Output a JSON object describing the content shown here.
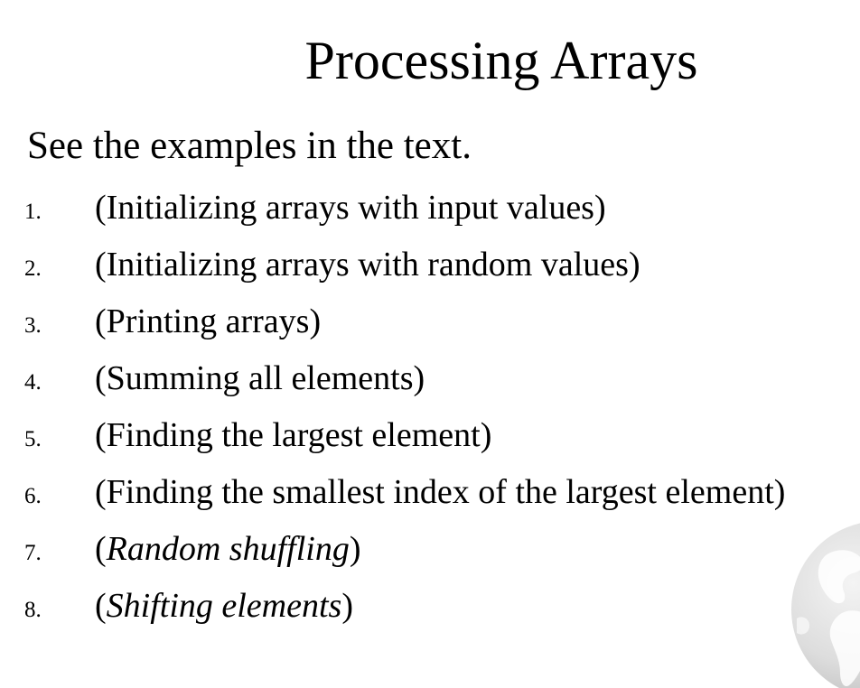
{
  "slide": {
    "title": "Processing Arrays",
    "intro": "See the examples in the text.",
    "items": [
      {
        "number": "1.",
        "before": "(",
        "text": "Initializing arrays with input values",
        "after": ")",
        "italic": false
      },
      {
        "number": "2.",
        "before": "(",
        "text": "Initializing arrays with random values",
        "after": ")",
        "italic": false
      },
      {
        "number": "3.",
        "before": "(",
        "text": "Printing arrays",
        "after": ")",
        "italic": false
      },
      {
        "number": "4.",
        "before": "(",
        "text": "Summing all elements",
        "after": ")",
        "italic": false
      },
      {
        "number": "5.",
        "before": "(",
        "text": "Finding the largest element",
        "after": ")",
        "italic": false
      },
      {
        "number": "6.",
        "before": "(",
        "text": "Finding the smallest index of the largest element",
        "after": ")",
        "italic": false
      },
      {
        "number": "7.",
        "before": "(",
        "text": "Random shuffling",
        "after": ")",
        "italic": true
      },
      {
        "number": "8.",
        "before": "(",
        "text": "Shifting elements",
        "after": ")",
        "italic": true
      }
    ],
    "decoration": {
      "icon": "globe-icon",
      "color": "#d6d6d6"
    }
  }
}
